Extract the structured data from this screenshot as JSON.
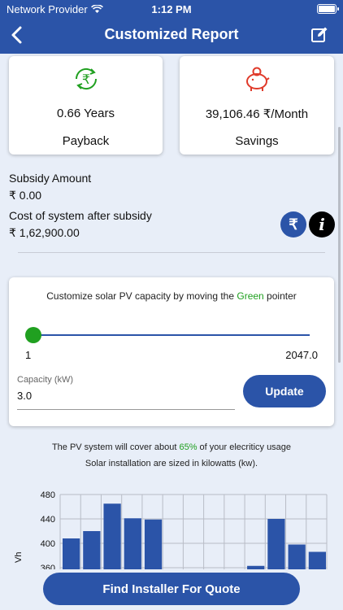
{
  "status": {
    "carrier": "Network Provider",
    "time": "1:12 PM"
  },
  "header": {
    "title": "Customized Report"
  },
  "metrics": [
    {
      "value": "0.66 Years",
      "label": "Payback",
      "icon": "rupee-cycle-icon"
    },
    {
      "value": "39,106.46 ₹/Month",
      "label": "Savings",
      "icon": "piggy-bank-icon"
    }
  ],
  "subsidy": {
    "label": "Subsidy Amount",
    "value": "₹ 0.00",
    "cost_label": "Cost of system after subsidy",
    "cost_value": "₹ 1,62,900.00",
    "rupee_glyph": "₹",
    "info_glyph": "i"
  },
  "slider": {
    "title_prefix": "Customize solar PV capacity by moving the ",
    "title_highlight": "Green",
    "title_suffix": " pointer",
    "min": "1",
    "max": "2047.0",
    "level": 0.0,
    "capacity_label": "Capacity (kW)",
    "capacity_value": "3.0",
    "update_label": "Update"
  },
  "coverage": {
    "line1_prefix": "The PV system will cover about ",
    "line1_highlight": "65%",
    "line1_suffix": " of your elecriticy usage",
    "line2": "Solar installation are sized in kilowatts (kw)."
  },
  "chart_data": {
    "type": "bar",
    "ylabel": "Vh",
    "y_ticks": [
      "480",
      "440",
      "400",
      "360"
    ],
    "ylim": [
      360,
      480
    ],
    "values": [
      408,
      420,
      465,
      441,
      439,
      null,
      null,
      null,
      null,
      363,
      440,
      398,
      386
    ],
    "grid": true,
    "bar_color": "#2b54a8"
  },
  "footer": {
    "cta": "Find Installer For Quote"
  },
  "colors": {
    "primary": "#2b54a8",
    "green": "#20a020",
    "red": "#e03a2a"
  }
}
